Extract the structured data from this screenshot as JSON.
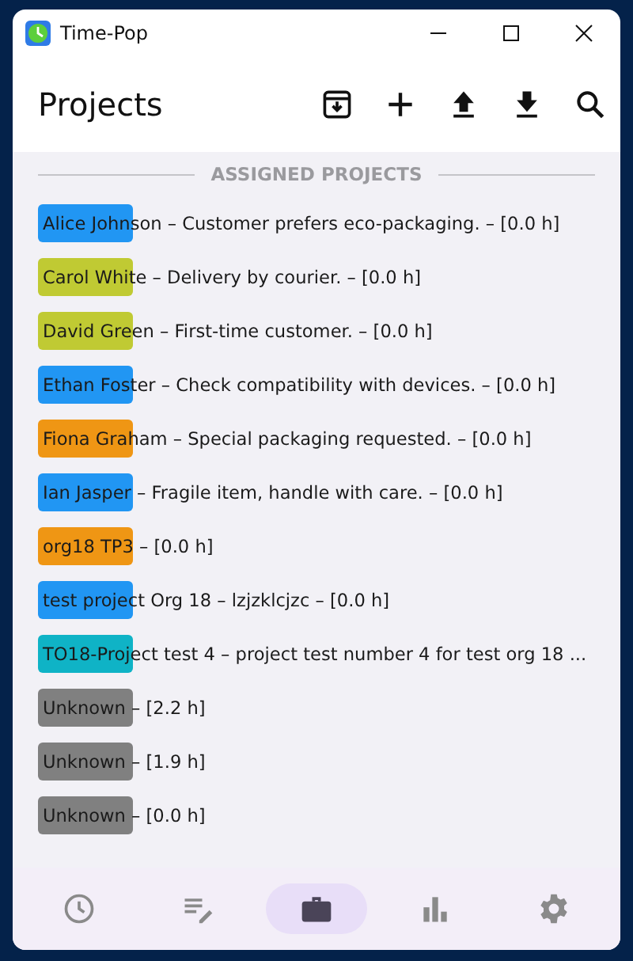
{
  "window": {
    "title": "Time-Pop"
  },
  "header": {
    "title": "Projects"
  },
  "section": {
    "title": "ASSIGNED PROJECTS"
  },
  "projects": [
    {
      "label": "Alice Johnson – Customer prefers eco-packaging. – [0.0 h]",
      "color": "#2196f3"
    },
    {
      "label": "Carol White – Delivery by courier. – [0.0 h]",
      "color": "#c0ca33"
    },
    {
      "label": "David Green – First-time customer. – [0.0 h]",
      "color": "#c0ca33"
    },
    {
      "label": "Ethan Foster – Check compatibility with devices. – [0.0 h]",
      "color": "#2196f3"
    },
    {
      "label": "Fiona Graham – Special packaging requested. – [0.0 h]",
      "color": "#ef9614"
    },
    {
      "label": "Ian Jasper – Fragile item, handle with care. – [0.0 h]",
      "color": "#2196f3"
    },
    {
      "label": "org18 TP3 – [0.0 h]",
      "color": "#ef9614"
    },
    {
      "label": "test project Org 18 – lzjzklcjzc – [0.0 h]",
      "color": "#2196f3"
    },
    {
      "label": "TO18-Project test 4 – project test number 4 for test org 18 ...",
      "color": "#0fb3c6"
    },
    {
      "label": "Unknown – [2.2 h]",
      "color": "#808080"
    },
    {
      "label": "Unknown – [1.9 h]",
      "color": "#808080"
    },
    {
      "label": "Unknown – [0.0 h]",
      "color": "#808080"
    }
  ],
  "nav": [
    {
      "kind": "clock",
      "selected": false
    },
    {
      "kind": "edit",
      "selected": false
    },
    {
      "kind": "briefcase",
      "selected": true
    },
    {
      "kind": "chart",
      "selected": false
    },
    {
      "kind": "settings",
      "selected": false
    }
  ]
}
